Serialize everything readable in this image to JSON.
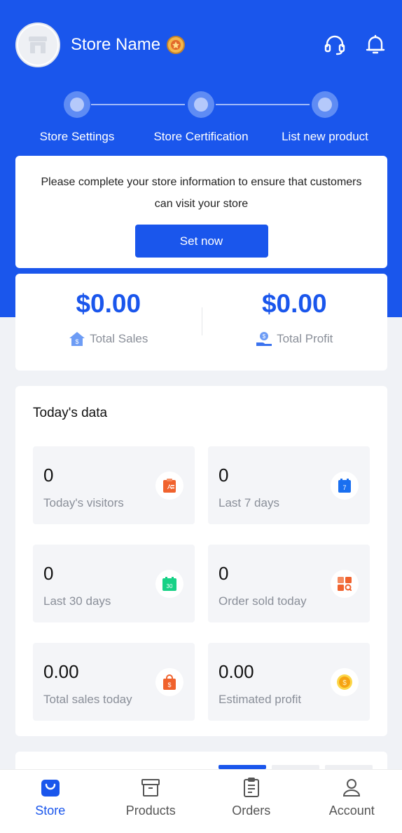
{
  "header": {
    "store_name": "Store Name",
    "icons": [
      "store-avatar-icon",
      "badge-icon",
      "headset-icon",
      "bell-icon"
    ]
  },
  "steps": [
    {
      "label": "Store Settings"
    },
    {
      "label": "Store Certification"
    },
    {
      "label": "List new product"
    }
  ],
  "notice": {
    "text": "Please complete your store information to ensure that customers can visit your store",
    "button_label": "Set now"
  },
  "totals": {
    "sales_value": "$0.00",
    "sales_label": "Total Sales",
    "profit_value": "$0.00",
    "profit_label": "Total Profit"
  },
  "today": {
    "title": "Today's data",
    "stats": [
      {
        "value": "0",
        "label": "Today's visitors",
        "icon": "visitors-icon"
      },
      {
        "value": "0",
        "label": "Last 7 days",
        "icon": "calendar-7-icon"
      },
      {
        "value": "0",
        "label": "Last 30 days",
        "icon": "calendar-30-icon"
      },
      {
        "value": "0",
        "label": "Order sold today",
        "icon": "orders-grid-icon"
      },
      {
        "value": "0.00",
        "label": "Total sales today",
        "icon": "shopping-bag-icon"
      },
      {
        "value": "0.00",
        "label": "Estimated profit",
        "icon": "coin-icon"
      }
    ]
  },
  "tabbar": {
    "items": [
      {
        "label": "Store",
        "icon": "store-bag-icon",
        "active": true
      },
      {
        "label": "Products",
        "icon": "box-icon",
        "active": false
      },
      {
        "label": "Orders",
        "icon": "clipboard-icon",
        "active": false
      },
      {
        "label": "Account",
        "icon": "person-icon",
        "active": false
      }
    ]
  },
  "colors": {
    "primary": "#1a56ec",
    "muted_text": "#8a8f99",
    "page_bg": "#f0f2f6"
  }
}
